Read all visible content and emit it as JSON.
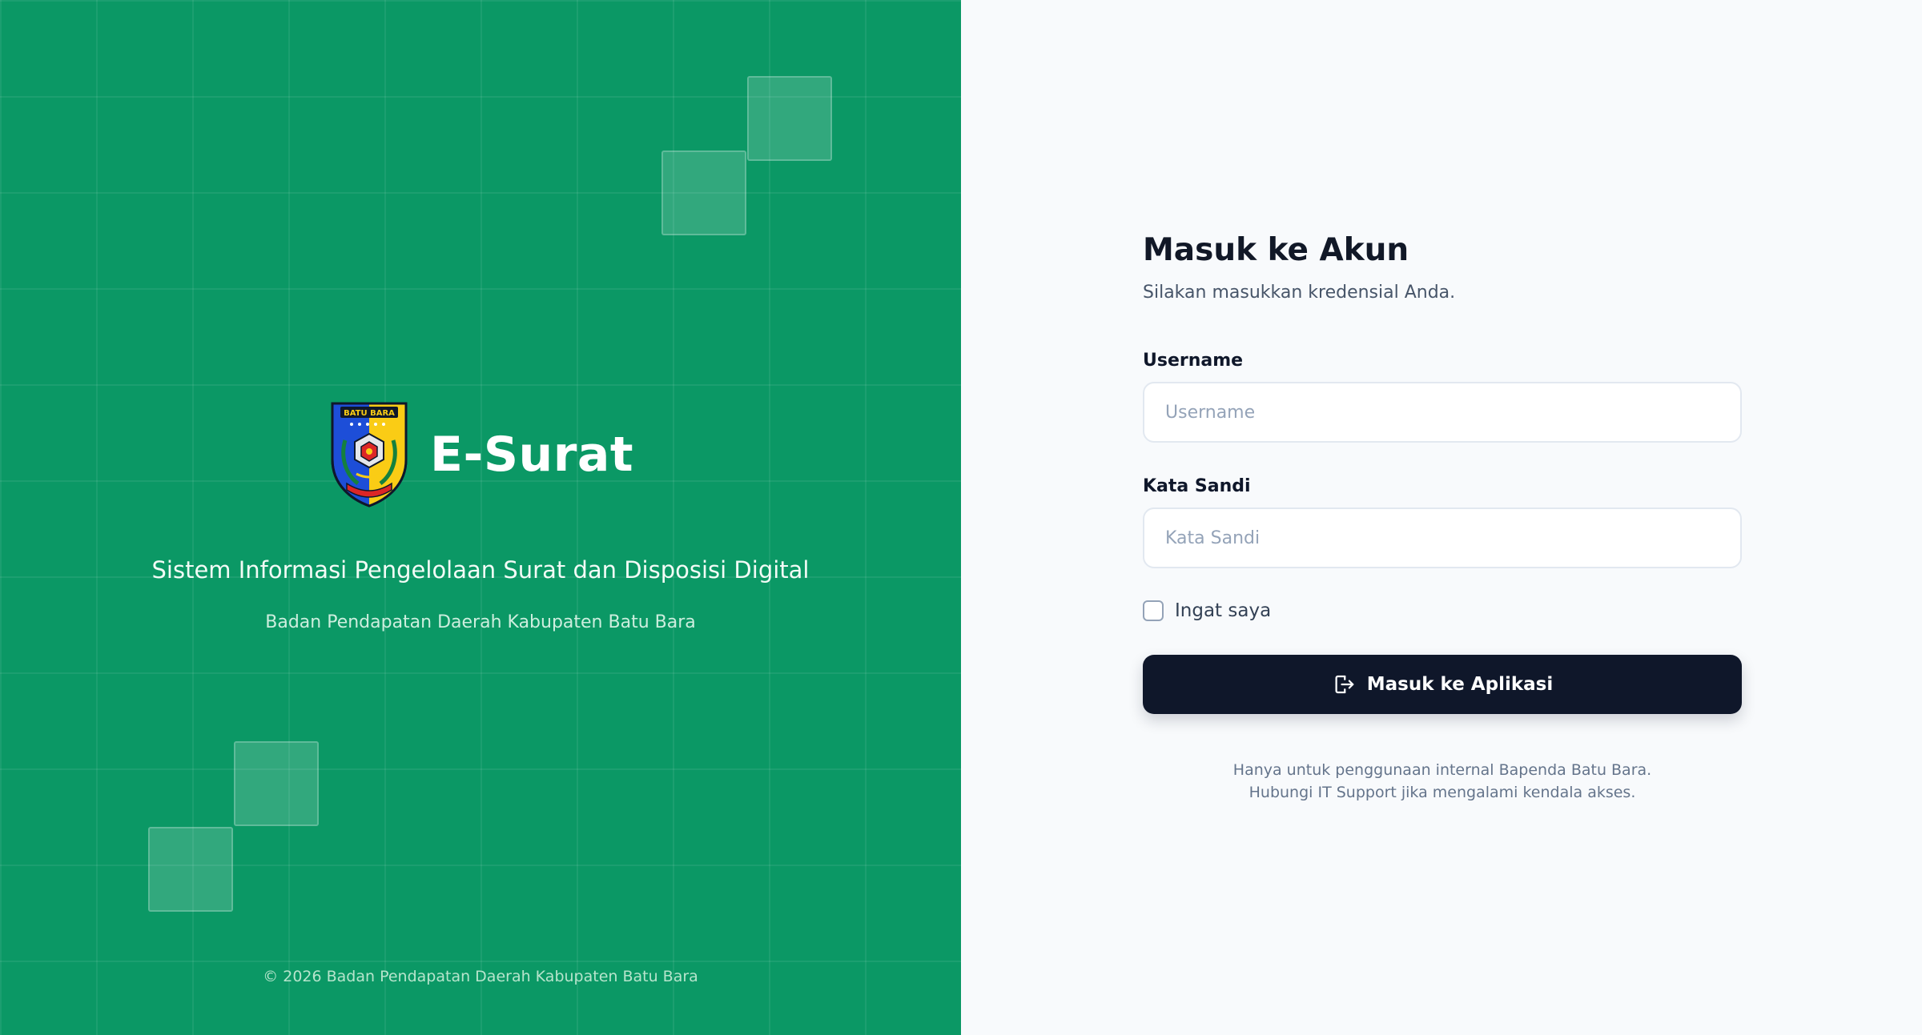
{
  "branding": {
    "app_name": "E-Surat",
    "tagline": "Sistem Informasi Pengelolaan Surat dan Disposisi Digital",
    "organization": "Badan Pendapatan Daerah Kabupaten Batu Bara",
    "copyright": "© 2026 Badan Pendapatan Daerah Kabupaten Batu Bara",
    "emblem": {
      "icon": "batu-bara-regency-emblem",
      "banner_text": "BATU BARA"
    }
  },
  "login_form": {
    "title": "Masuk ke Akun",
    "subtitle": "Silakan masukkan kredensial Anda.",
    "username": {
      "label": "Username",
      "placeholder": "Username",
      "value": ""
    },
    "password": {
      "label": "Kata Sandi",
      "placeholder": "Kata Sandi",
      "value": ""
    },
    "remember_me": {
      "label": "Ingat saya",
      "checked": false
    },
    "submit": {
      "label": "Masuk ke Aplikasi",
      "icon": "login-icon"
    },
    "footnote_lines": [
      "Hanya untuk penggunaan internal Bapenda Batu Bara.",
      "Hubungi IT Support jika mengalami kendala akses."
    ]
  },
  "colors": {
    "brand_green": "#0b9865",
    "button_dark": "#0f172a",
    "page_background": "#f8fafc"
  }
}
